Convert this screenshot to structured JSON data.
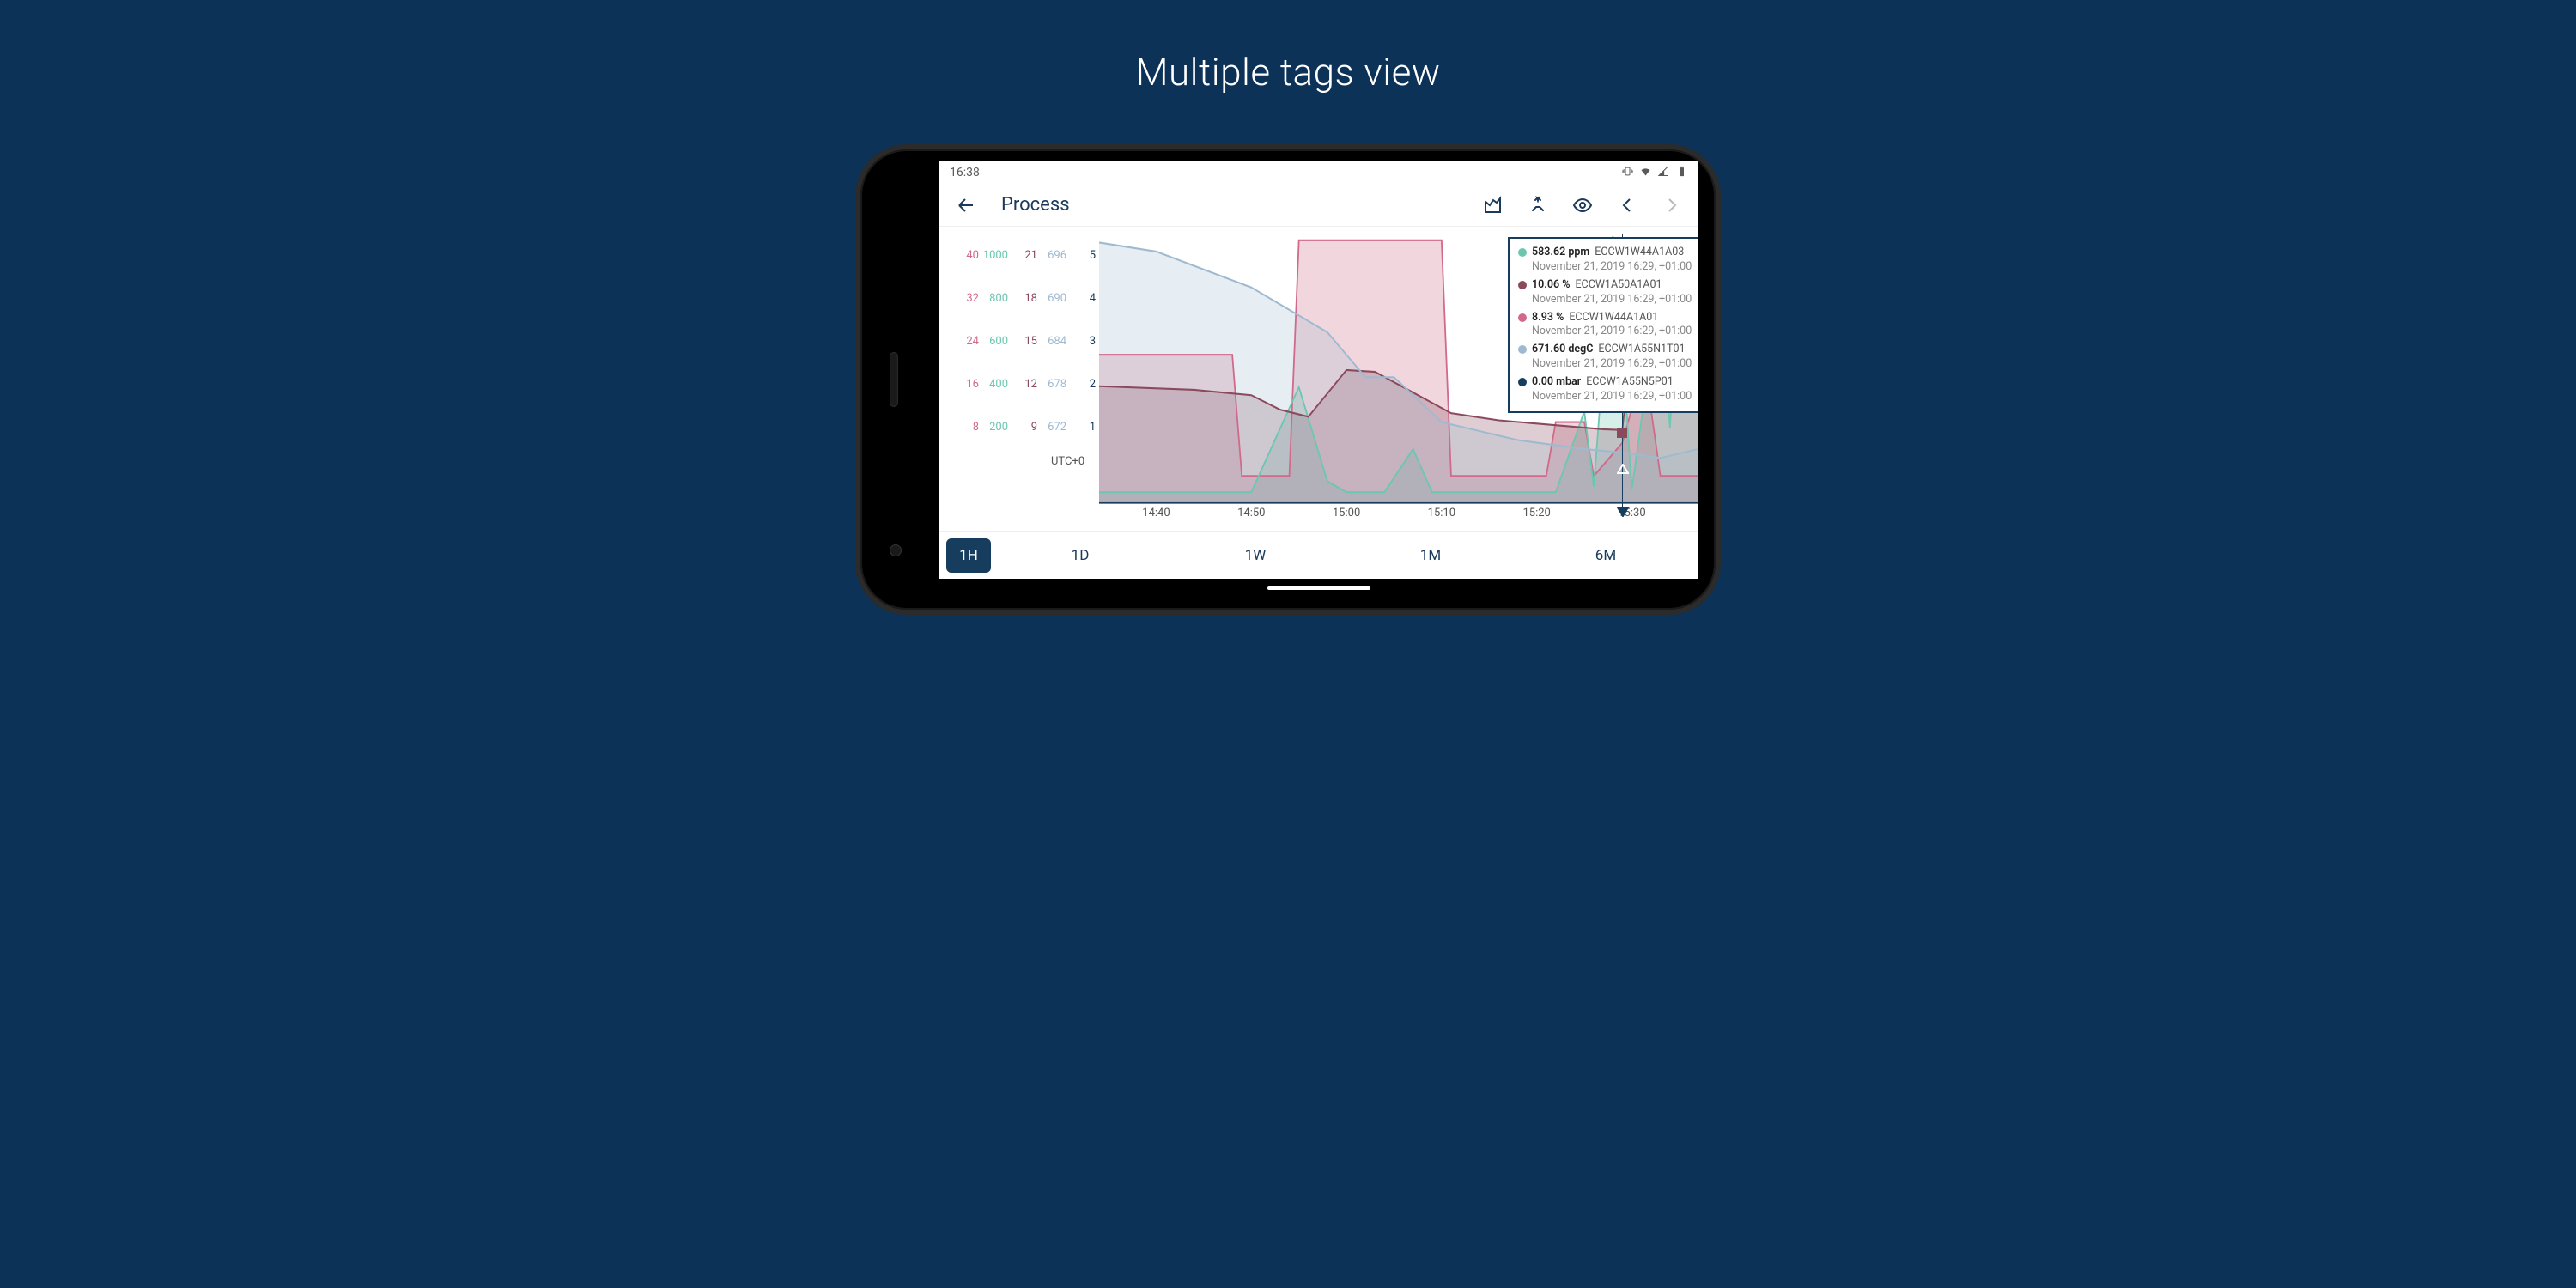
{
  "promo_title": "Multiple tags view",
  "status": {
    "time": "16:38"
  },
  "toolbar": {
    "title": "Process"
  },
  "series_colors": {
    "s1": "#d06a8a",
    "s2": "#6cc7b0",
    "s3": "#8a4a5c",
    "s4": "#9fbad0",
    "s5": "#163c5e"
  },
  "y_axes": {
    "rows": [
      {
        "s1": "40",
        "s2": "1000",
        "s3": "21",
        "s4": "696",
        "s5": "5"
      },
      {
        "s1": "32",
        "s2": "800",
        "s3": "18",
        "s4": "690",
        "s5": "4"
      },
      {
        "s1": "24",
        "s2": "600",
        "s3": "15",
        "s4": "684",
        "s5": "3"
      },
      {
        "s1": "16",
        "s2": "400",
        "s3": "12",
        "s4": "678",
        "s5": "2"
      },
      {
        "s1": "8",
        "s2": "200",
        "s3": "9",
        "s4": "672",
        "s5": "1"
      }
    ],
    "tz_label": "UTC+0"
  },
  "x_ticks": [
    "14:40",
    "14:50",
    "15:00",
    "15:10",
    "15:20",
    "15:30"
  ],
  "tooltip": {
    "items": [
      {
        "color": "#6cc7b0",
        "value": "583.62 ppm",
        "tag": "ECCW1W44A1A03",
        "time": "November 21, 2019 16:29, +01:00"
      },
      {
        "color": "#8a4a5c",
        "value": "10.06 %",
        "tag": "ECCW1A50A1A01",
        "time": "November 21, 2019 16:29, +01:00"
      },
      {
        "color": "#d06a8a",
        "value": "8.93 %",
        "tag": "ECCW1W44A1A01",
        "time": "November 21, 2019 16:29, +01:00"
      },
      {
        "color": "#9fbad0",
        "value": "671.60 degC",
        "tag": "ECCW1A55N1T01",
        "time": "November 21, 2019 16:29, +01:00"
      },
      {
        "color": "#163c5e",
        "value": "0.00 mbar",
        "tag": "ECCW1A55N5P01",
        "time": "November 21, 2019 16:29, +01:00"
      }
    ]
  },
  "ranges": [
    {
      "label": "1H",
      "active": true
    },
    {
      "label": "1D",
      "active": false
    },
    {
      "label": "1W",
      "active": false
    },
    {
      "label": "1M",
      "active": false
    },
    {
      "label": "6M",
      "active": false
    }
  ],
  "chart_data": {
    "type": "line",
    "x_range_minutes": [
      34,
      37
    ],
    "x_tick_labels": [
      "14:40",
      "14:50",
      "15:00",
      "15:10",
      "15:20",
      "15:30"
    ],
    "cursor_at": "15:29",
    "series": [
      {
        "name": "ECCW1W44A1A01",
        "unit": "%",
        "color": "#d06a8a",
        "y_range": [
          0,
          40
        ],
        "points": [
          {
            "t": "14:34",
            "v": 22
          },
          {
            "t": "14:40",
            "v": 22
          },
          {
            "t": "14:48",
            "v": 22
          },
          {
            "t": "14:49",
            "v": 4
          },
          {
            "t": "14:54",
            "v": 4
          },
          {
            "t": "14:55",
            "v": 39
          },
          {
            "t": "15:10",
            "v": 39
          },
          {
            "t": "15:11",
            "v": 4
          },
          {
            "t": "15:21",
            "v": 4
          },
          {
            "t": "15:22",
            "v": 12
          },
          {
            "t": "15:25",
            "v": 12
          },
          {
            "t": "15:26",
            "v": 4
          },
          {
            "t": "15:29",
            "v": 8.93
          },
          {
            "t": "15:30",
            "v": 14
          },
          {
            "t": "15:32",
            "v": 14
          },
          {
            "t": "15:33",
            "v": 4
          },
          {
            "t": "15:37",
            "v": 4
          }
        ]
      },
      {
        "name": "ECCW1W44A1A03",
        "unit": "ppm",
        "color": "#6cc7b0",
        "y_range": [
          0,
          1000
        ],
        "points": [
          {
            "t": "14:34",
            "v": 40
          },
          {
            "t": "14:50",
            "v": 40
          },
          {
            "t": "14:55",
            "v": 430
          },
          {
            "t": "14:58",
            "v": 80
          },
          {
            "t": "15:00",
            "v": 40
          },
          {
            "t": "15:04",
            "v": 40
          },
          {
            "t": "15:07",
            "v": 200
          },
          {
            "t": "15:09",
            "v": 40
          },
          {
            "t": "15:22",
            "v": 40
          },
          {
            "t": "15:25",
            "v": 340
          },
          {
            "t": "15:26",
            "v": 60
          },
          {
            "t": "15:28",
            "v": 990
          },
          {
            "t": "15:29",
            "v": 583.62
          },
          {
            "t": "15:30",
            "v": 50
          },
          {
            "t": "15:33",
            "v": 820
          },
          {
            "t": "15:34",
            "v": 280
          },
          {
            "t": "15:35",
            "v": 780
          },
          {
            "t": "15:36",
            "v": 360
          },
          {
            "t": "15:37",
            "v": 360
          }
        ]
      },
      {
        "name": "ECCW1A50A1A01",
        "unit": "%",
        "color": "#8a4a5c",
        "y_range": [
          6,
          21
        ],
        "points": [
          {
            "t": "14:34",
            "v": 12.5
          },
          {
            "t": "14:44",
            "v": 12.3
          },
          {
            "t": "14:50",
            "v": 12.0
          },
          {
            "t": "14:53",
            "v": 11.2
          },
          {
            "t": "14:56",
            "v": 10.8
          },
          {
            "t": "15:00",
            "v": 13.4
          },
          {
            "t": "15:03",
            "v": 13.3
          },
          {
            "t": "15:11",
            "v": 11.0
          },
          {
            "t": "15:16",
            "v": 10.6
          },
          {
            "t": "15:27",
            "v": 10.1
          },
          {
            "t": "15:29",
            "v": 10.06
          },
          {
            "t": "15:31",
            "v": 20.5
          },
          {
            "t": "15:33",
            "v": 12.5
          },
          {
            "t": "15:35",
            "v": 16.5
          },
          {
            "t": "15:36",
            "v": 13.0
          },
          {
            "t": "15:37",
            "v": 13.0
          }
        ]
      },
      {
        "name": "ECCW1A55N1T01",
        "unit": "degC",
        "color": "#9fbad0",
        "y_range": [
          666,
          696
        ],
        "points": [
          {
            "t": "14:34",
            "v": 695
          },
          {
            "t": "14:40",
            "v": 694
          },
          {
            "t": "14:50",
            "v": 690
          },
          {
            "t": "14:58",
            "v": 685
          },
          {
            "t": "15:02",
            "v": 680
          },
          {
            "t": "15:05",
            "v": 680
          },
          {
            "t": "15:10",
            "v": 675
          },
          {
            "t": "15:18",
            "v": 673
          },
          {
            "t": "15:25",
            "v": 672
          },
          {
            "t": "15:29",
            "v": 671.6
          },
          {
            "t": "15:33",
            "v": 671
          },
          {
            "t": "15:37",
            "v": 672
          }
        ]
      },
      {
        "name": "ECCW1A55N5P01",
        "unit": "mbar",
        "color": "#163c5e",
        "y_range": [
          0,
          5
        ],
        "points": [
          {
            "t": "14:34",
            "v": 0
          },
          {
            "t": "15:29",
            "v": 0
          },
          {
            "t": "15:37",
            "v": 0
          }
        ]
      }
    ]
  }
}
